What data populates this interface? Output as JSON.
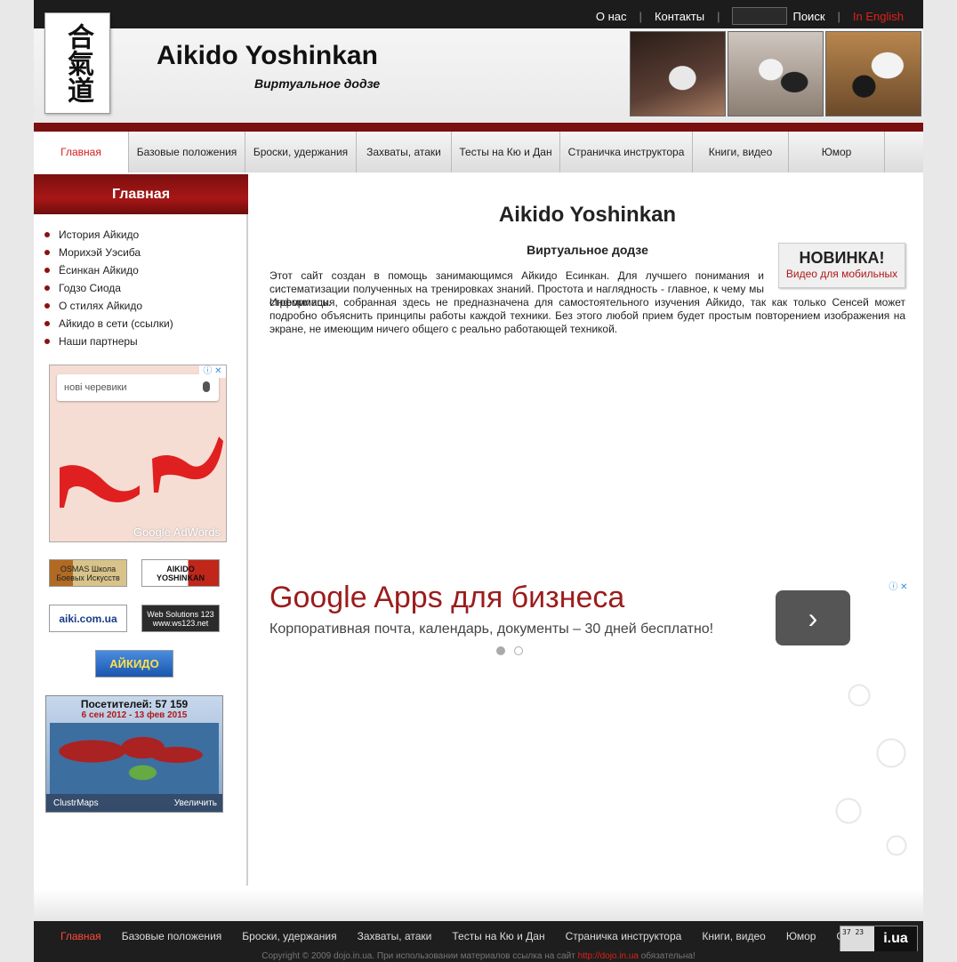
{
  "top": {
    "about": "О нас",
    "contacts": "Контакты",
    "search_value": "",
    "search_label": "Поиск",
    "english": "In English"
  },
  "header": {
    "logo_text": "合氣道",
    "title": "Aikido Yoshinkan",
    "subtitle": "Виртуальное додзе"
  },
  "nav": [
    {
      "label": "Главная",
      "w": 107
    },
    {
      "label": "Базовые положения",
      "w": 131
    },
    {
      "label": "Броски, удержания",
      "w": 125
    },
    {
      "label": "Захваты, атаки",
      "w": 107
    },
    {
      "label": "Тесты на Кю и Дан",
      "w": 122
    },
    {
      "label": "Страничка инструктора",
      "w": 149
    },
    {
      "label": "Книги, видео",
      "w": 108
    },
    {
      "label": "Юмор",
      "w": 108
    }
  ],
  "sidebar": {
    "title": "Главная",
    "items": [
      "История Айкидо",
      "Морихэй Уэсиба",
      "Ёсинкан Айкидо",
      "Годзо Сиода",
      "О стилях Айкидо",
      "Айкидо в сети (ссылки)",
      "Наши партнеры"
    ],
    "ad_search": "нові черевики",
    "ad_brand": "Google AdWords",
    "banners": {
      "osmas": "OSMAS Школа Боевых Искусств",
      "aikido_yoshinkan": "AIKIDO YOSHINKAN",
      "aiki": "aiki.com.ua",
      "ws": "Web Solutions 123 www.ws123.net",
      "aikido": "АЙКИДО"
    },
    "clustr": {
      "visitors": "Посетителей: 57 159",
      "dates": "6 сен 2012 - 13 фев 2015",
      "brand": "ClustrMaps",
      "zoom": "Увеличить"
    }
  },
  "main": {
    "title": "Aikido Yoshinkan",
    "subtitle": "Виртуальное додзе",
    "new_title": "НОВИНКА!",
    "new_link": "Видео для мобильных",
    "p1": "Этот сайт создан в помощь занимающимся Айкидо Есинкан. Для лучшего понимания и систематизации полученных на тренировках знаний. Простота и наглядность - главное, к чему мы стремились.",
    "p1b": "Информация, собранная здесь не предназначена для самостоятельного изучения Айкидо, так как только Сенсей может подробно объяснить принципы работы каждой техники. Без этого любой прием будет простым повторением изображения на экране, не имеющим ничего общего с реально работающей техникой.",
    "ad_title": "Google Apps для бизнеса",
    "ad_sub": "Корпоративная почта, календарь, документы – 30 дней бесплатно!",
    "ad_btn": "›"
  },
  "footer": {
    "items": [
      "Главная",
      "Базовые положения",
      "Броски, удержания",
      "Захваты, атаки",
      "Тесты на Кю и Дан",
      "Страничка инструктора",
      "Книги, видео",
      "Юмор",
      "Ссылки"
    ],
    "counter_small": "37 23",
    "counter_brand": "i.ua",
    "copyright_pre": "Copyright © 2009 dojo.in.ua. При использовании материалов ссылка на сайт ",
    "copyright_link": "http://dojo.in.ua",
    "copyright_post": " обязательна!"
  }
}
